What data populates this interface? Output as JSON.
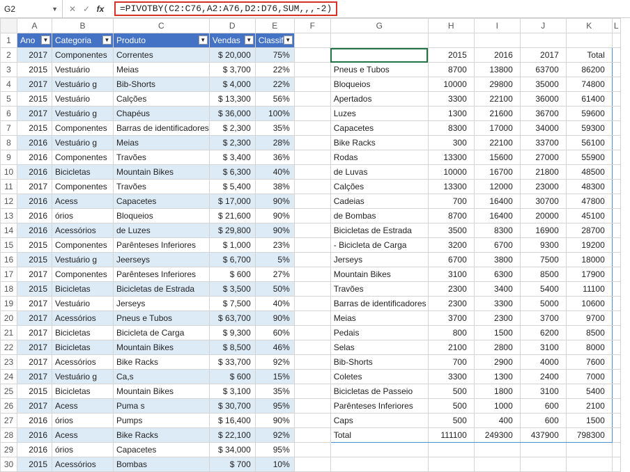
{
  "namebox": "G2",
  "formula": "=PIVOTBY(C2:C76,A2:A76,D2:D76,SUM,,,-2)",
  "col_letters": [
    "A",
    "B",
    "C",
    "D",
    "E",
    "F",
    "G",
    "H",
    "I",
    "J",
    "K",
    "L"
  ],
  "headers": {
    "A": "Ano",
    "B": "Categoria",
    "C": "Produto",
    "D": "Vendas",
    "E": "Classific"
  },
  "data_rows": [
    {
      "A": "2017",
      "B": "Componentes",
      "C": "Correntes",
      "D": "$ 20,000",
      "E": "75%"
    },
    {
      "A": "2015",
      "B": "Vestuário",
      "C": "Meias",
      "D": "$  3,700",
      "E": "22%"
    },
    {
      "A": "2017",
      "B": "Vestuário g",
      "C": "Bib-Shorts",
      "D": "$  4,000",
      "E": "22%"
    },
    {
      "A": "2015",
      "B": "Vestuário",
      "C": "Calções",
      "D": "$ 13,300",
      "E": "56%"
    },
    {
      "A": "2017",
      "B": "Vestuário g",
      "C": "Chapéus",
      "D": "$ 36,000",
      "E": "100%"
    },
    {
      "A": "2015",
      "B": "Componentes",
      "C": "Barras de identificadores",
      "D": "$  2,300",
      "E": "35%"
    },
    {
      "A": "2016",
      "B": "Vestuário g",
      "C": "Meias",
      "D": "$  2,300",
      "E": "28%"
    },
    {
      "A": "2016",
      "B": "Componentes",
      "C": "Travões",
      "D": "$  3,400",
      "E": "36%"
    },
    {
      "A": "2016",
      "B": "Bicicletas",
      "C": "Mountain Bikes",
      "D": "$  6,300",
      "E": "40%"
    },
    {
      "A": "2017",
      "B": "Componentes",
      "C": "Travões",
      "D": "$  5,400",
      "E": "38%"
    },
    {
      "A": "2016",
      "B": "Acess",
      "C": "Capacetes",
      "D": "$ 17,000",
      "E": "90%"
    },
    {
      "A": "2016",
      "B": "órios",
      "C": "Bloqueios",
      "D": "$ 21,600",
      "E": "90%"
    },
    {
      "A": "2016",
      "B": "Acessórios",
      "C": "de Luzes",
      "D": "$ 29,800",
      "E": "90%"
    },
    {
      "A": "2015",
      "B": "Componentes",
      "C": "Parênteses Inferiores",
      "D": "$  1,000",
      "E": "23%"
    },
    {
      "A": "2015",
      "B": "Vestuário g",
      "C": "Jeerseys",
      "D": "$  6,700",
      "E": "5%"
    },
    {
      "A": "2017",
      "B": "Componentes",
      "C": "Parênteses Inferiores",
      "D": "$    600",
      "E": "27%"
    },
    {
      "A": "2015",
      "B": "Bicicletas",
      "C": "Bicicletas de Estrada",
      "D": "$  3,500",
      "E": "50%"
    },
    {
      "A": "2017",
      "B": "Vestuário",
      "C": "Jerseys",
      "D": "$  7,500",
      "E": "40%"
    },
    {
      "A": "2017",
      "B": "Acessórios",
      "C": "Pneus e Tubos",
      "D": "$ 63,700",
      "E": "90%"
    },
    {
      "A": "2017",
      "B": "Bicicletas",
      "C": "Bicicleta de Carga",
      "D": "$  9,300",
      "E": "60%"
    },
    {
      "A": "2017",
      "B": "Bicicletas",
      "C": "Mountain Bikes",
      "D": "$  8,500",
      "E": "46%"
    },
    {
      "A": "2017",
      "B": "Acessórios",
      "C": "Bike Racks",
      "D": "$ 33,700",
      "E": "92%"
    },
    {
      "A": "2017",
      "B": "Vestuário g",
      "C": "Ca,s",
      "D": "$    600",
      "E": "15%"
    },
    {
      "A": "2015",
      "B": "Bicicletas",
      "C": "Mountain Bikes",
      "D": "$  3,100",
      "E": "35%"
    },
    {
      "A": "2017",
      "B": "Acess",
      "C": "Puma s",
      "D": "$ 30,700",
      "E": "95%"
    },
    {
      "A": "2016",
      "B": "órios",
      "C": "Pumps",
      "D": "$ 16,400",
      "E": "90%"
    },
    {
      "A": "2016",
      "B": "Acess",
      "C": "Bike Racks",
      "D": "$ 22,100",
      "E": "92%"
    },
    {
      "A": "2016",
      "B": "órios",
      "C": "Capacetes",
      "D": "$ 34,000",
      "E": "95%"
    },
    {
      "A": "2015",
      "B": "Acessórios",
      "C": "Bombas",
      "D": "$    700",
      "E": "10%"
    }
  ],
  "pivot_header": {
    "G": "",
    "H": "2015",
    "I": "2016",
    "J": "2017",
    "K": "Total"
  },
  "pivot_rows": [
    {
      "G": "Pneus e Tubos",
      "H": "8700",
      "I": "13800",
      "J": "63700",
      "K": "86200"
    },
    {
      "G": "Bloqueios",
      "H": "10000",
      "I": "29800",
      "J": "35000",
      "K": "74800"
    },
    {
      "G": "Apertados",
      "H": "3300",
      "I": "22100",
      "J": "36000",
      "K": "61400"
    },
    {
      "G": "Luzes",
      "H": "1300",
      "I": "21600",
      "J": "36700",
      "K": "59600"
    },
    {
      "G": "Capacetes",
      "H": "8300",
      "I": "17000",
      "J": "34000",
      "K": "59300"
    },
    {
      "G": "Bike Racks",
      "H": "300",
      "I": "22100",
      "J": "33700",
      "K": "56100"
    },
    {
      "G": " Rodas",
      "H": "13300",
      "I": "15600",
      "J": "27000",
      "K": "55900"
    },
    {
      "G": "de Luvas",
      "H": "10000",
      "I": "16700",
      "J": "21800",
      "K": "48500"
    },
    {
      "G": "Calções",
      "H": "13300",
      "I": "12000",
      "J": "23000",
      "K": "48300"
    },
    {
      "G": "Cadeias",
      "H": "700",
      "I": "16400",
      "J": "30700",
      "K": "47800"
    },
    {
      "G": "de Bombas",
      "H": "8700",
      "I": "16400",
      "J": "20000",
      "K": "45100"
    },
    {
      "G": "Bicicletas de Estrada",
      "H": "3500",
      "I": "8300",
      "J": "16900",
      "K": "28700"
    },
    {
      "G": "- Bicicleta de Carga",
      "H": "3200",
      "I": "6700",
      "J": "9300",
      "K": "19200"
    },
    {
      "G": "Jerseys",
      "H": "6700",
      "I": "3800",
      "J": "7500",
      "K": "18000"
    },
    {
      "G": "Mountain Bikes",
      "H": "3100",
      "I": "6300",
      "J": "8500",
      "K": "17900"
    },
    {
      "G": "Travões",
      "H": "2300",
      "I": "3400",
      "J": "5400",
      "K": "11100"
    },
    {
      "G": "Barras de identificadores",
      "H": "2300",
      "I": "3300",
      "J": "5000",
      "K": "10600"
    },
    {
      "G": "Meias",
      "H": "3700",
      "I": "2300",
      "J": "3700",
      "K": "9700"
    },
    {
      "G": "Pedais",
      "H": "800",
      "I": "1500",
      "J": "6200",
      "K": "8500"
    },
    {
      "G": "Selas",
      "H": "2100",
      "I": "2800",
      "J": "3100",
      "K": "8000"
    },
    {
      "G": "Bib-Shorts",
      "H": "700",
      "I": "2900",
      "J": "4000",
      "K": "7600"
    },
    {
      "G": "Coletes",
      "H": "3300",
      "I": "1300",
      "J": "2400",
      "K": "7000"
    },
    {
      "G": "Bicicletas de Passeio",
      "H": "500",
      "I": "1800",
      "J": "3100",
      "K": "5400"
    },
    {
      "G": "Parênteses Inferiores",
      "H": "500",
      "I": "1000",
      "J": "600",
      "K": "2100"
    },
    {
      "G": "Caps",
      "H": "500",
      "I": "400",
      "J": "600",
      "K": "1500"
    },
    {
      "G": "Total",
      "H": "111100",
      "I": "249300",
      "J": "437900",
      "K": "798300"
    }
  ]
}
